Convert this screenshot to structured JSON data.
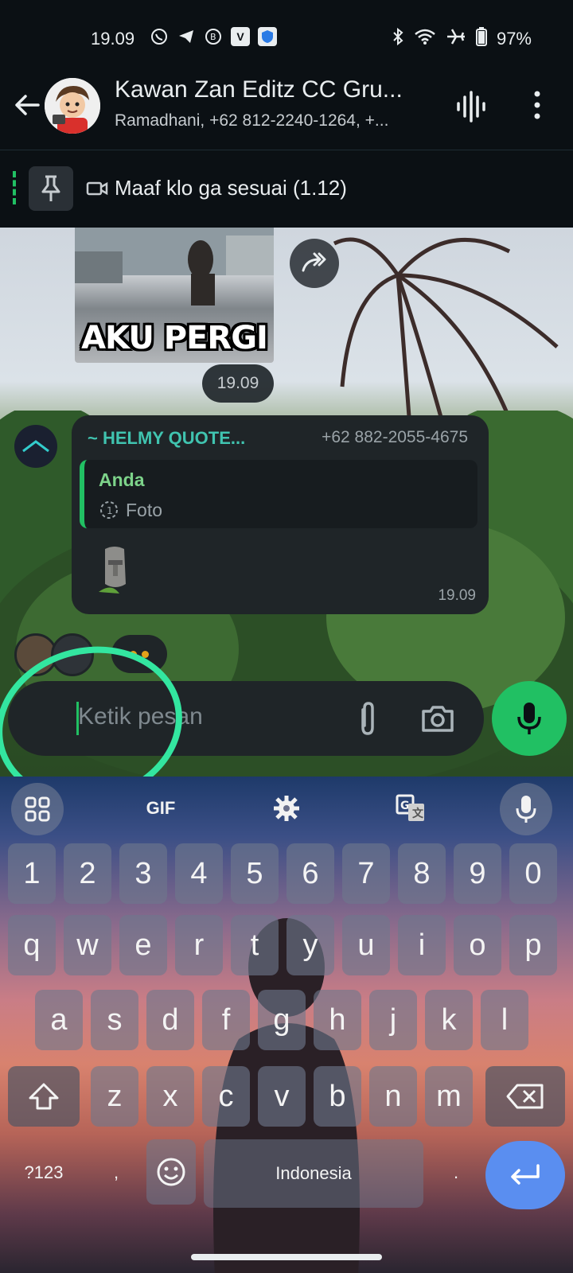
{
  "status_bar": {
    "time": "19.09",
    "battery": "97%",
    "icons": [
      "whatsapp-icon",
      "telegram-icon",
      "whatsapp-business-icon",
      "vidmate-icon",
      "shield-app-icon",
      "bluetooth-icon",
      "wifi-icon",
      "airplane-icon",
      "battery-icon"
    ]
  },
  "header": {
    "title": "Kawan Zan Editz CC Gru...",
    "subtitle": "Ramadhani, +62 812-2240-1264, +..."
  },
  "pinned": {
    "text": "Maaf klo ga sesuai (1.12)"
  },
  "messages": {
    "sticker": {
      "caption": "AKU PERGI",
      "time": "19.09"
    },
    "reply": {
      "sender_name": "~ HELMY QUOTE...",
      "sender_phone": "+62 882-2055-4675",
      "quoted_author": "Anda",
      "quoted_text": "Foto",
      "time": "19.09"
    }
  },
  "composer": {
    "placeholder": "Ketik pesan"
  },
  "keyboard": {
    "toolbar": {
      "gif_label": "GIF"
    },
    "row_numbers": [
      "1",
      "2",
      "3",
      "4",
      "5",
      "6",
      "7",
      "8",
      "9",
      "0"
    ],
    "row_1": [
      "q",
      "w",
      "e",
      "r",
      "t",
      "y",
      "u",
      "i",
      "o",
      "p"
    ],
    "row_2": [
      "a",
      "s",
      "d",
      "f",
      "g",
      "h",
      "j",
      "k",
      "l"
    ],
    "row_3": [
      "z",
      "x",
      "c",
      "v",
      "b",
      "n",
      "m"
    ],
    "symbols_label": "?123",
    "comma_label": ",",
    "space_label": "Indonesia",
    "period_label": "."
  },
  "colors": {
    "accent_green": "#21c063",
    "annotation_circle": "#33e6a0",
    "enter_key": "#5a8ef0"
  }
}
